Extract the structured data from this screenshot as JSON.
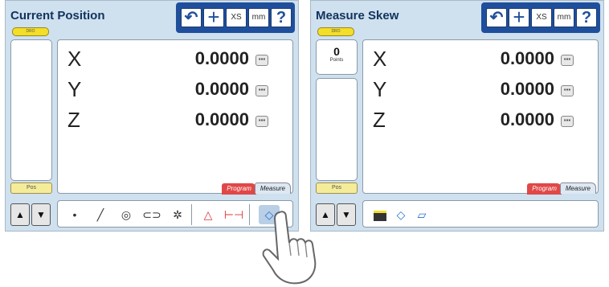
{
  "left": {
    "title": "Current Position",
    "dro_label": "DRO",
    "pos_label": "Pos",
    "axes": [
      {
        "label": "X",
        "value": "0.0000"
      },
      {
        "label": "Y",
        "value": "0.0000"
      },
      {
        "label": "Z",
        "value": "0.0000"
      }
    ],
    "tabs": {
      "program": "Program",
      "measure": "Measure"
    },
    "features": [
      "point",
      "line",
      "circle",
      "slot",
      "distance",
      "angle",
      "width",
      "skew"
    ]
  },
  "right": {
    "title": "Measure Skew",
    "dro_label": "DRO",
    "pos_label": "Pos",
    "points_count": "0",
    "points_label": "Points",
    "axes": [
      {
        "label": "X",
        "value": "0.0000"
      },
      {
        "label": "Y",
        "value": "0.0000"
      },
      {
        "label": "Z",
        "value": "0.0000"
      }
    ],
    "tabs": {
      "program": "Program",
      "measure": "Measure"
    },
    "skew_options": [
      "first-skew",
      "line-skew",
      "plane-skew"
    ]
  },
  "toolbar": {
    "undo_icon": "undo-icon",
    "datum_icon": "plus-icon",
    "xs_label": "XS",
    "mm_label": "mm",
    "help_label": "?"
  },
  "colors": {
    "toolbar": "#1f4f9c",
    "screen_bg": "#cfe0ef",
    "dro_tab": "#f3de2a",
    "program_tab": "#e04848"
  }
}
